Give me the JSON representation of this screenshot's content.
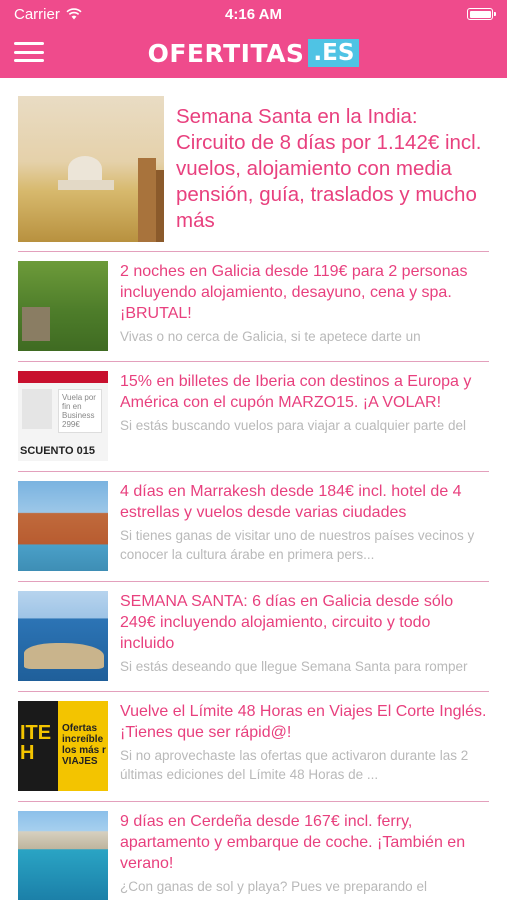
{
  "status_bar": {
    "carrier": "Carrier",
    "time": "4:16 AM",
    "battery_level": 1.0
  },
  "header": {
    "logo_main": "OFERTITAS",
    "logo_tld": ".ES",
    "brand_color": "#ef4b8c",
    "accent_color": "#4fc3e4"
  },
  "articles": [
    {
      "title": "Semana Santa en la India: Circuito de 8 días por 1.142€ incl. vuelos, alojamiento con media pensión, guía, traslados y mucho más",
      "excerpt": ""
    },
    {
      "title": "2 noches en Galicia desde 119€ para 2 personas incluyendo alojamiento, desayuno, cena y spa. ¡BRUTAL!",
      "excerpt": "Vivas o no cerca de Galicia, si te apetece darte un"
    },
    {
      "title": "15% en billetes de Iberia con destinos a Europa y América con el cupón MARZO15. ¡A VOLAR!",
      "excerpt": "Si estás buscando vuelos para viajar a cualquier parte del"
    },
    {
      "title": "4 días en Marrakesh desde 184€ incl. hotel de 4 estrellas y vuelos desde varias ciudades",
      "excerpt": "Si tienes ganas de visitar uno de nuestros países vecinos y conocer la cultura árabe en primera pers..."
    },
    {
      "title": "SEMANA SANTA: 6 días en Galicia desde sólo 249€ incluyendo alojamiento, circuito y todo incluido",
      "excerpt": "Si estás deseando que llegue Semana Santa para romper"
    },
    {
      "title": "Vuelve el Límite 48 Horas en Viajes El Corte Inglés. ¡Tienes que ser rápid@!",
      "excerpt": "Si no aprovechaste las ofertas que activaron durante las 2 últimas ediciones del Límite 48 Horas de ..."
    },
    {
      "title": "9 días en Cerdeña desde 167€ incl. ferry, apartamento y embarque de coche. ¡También en verano!",
      "excerpt": "¿Con ganas de sol y playa? Pues ve preparando el"
    }
  ],
  "thumbnail_text": {
    "iberia_panel": "Vuela por fin en Business 299€",
    "iberia_caption": "SCUENTO 015",
    "corte_letters": "ITE H",
    "corte_text": "Ofertas increíble los más r VIAJES"
  }
}
